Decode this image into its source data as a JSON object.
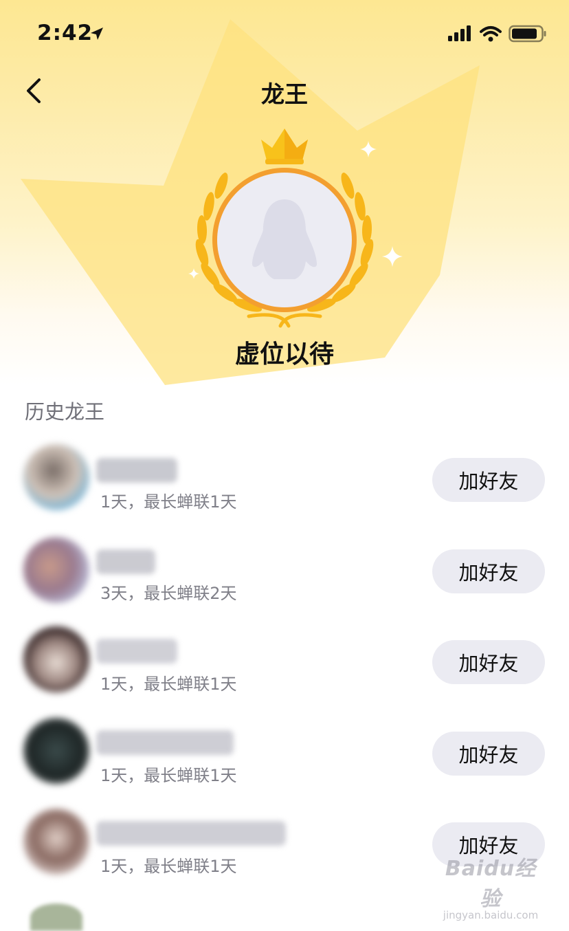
{
  "status_bar": {
    "time": "2:42"
  },
  "header": {
    "title": "龙王"
  },
  "winner": {
    "vacant_text": "虚位以待"
  },
  "history": {
    "section_title": "历史龙王",
    "rows": [
      {
        "subtitle": "1天，最长蝉联1天",
        "button_label": "加好友"
      },
      {
        "subtitle": "3天，最长蝉联2天",
        "button_label": "加好友"
      },
      {
        "subtitle": "1天，最长蝉联1天",
        "button_label": "加好友"
      },
      {
        "subtitle": "1天，最长蝉联1天",
        "button_label": "加好友"
      },
      {
        "subtitle": "1天，最长蝉联1天",
        "button_label": "加好友"
      }
    ]
  },
  "watermark": {
    "brand": "Baidu经验",
    "url": "jingyan.baidu.com"
  },
  "colors": {
    "accent_gold": "#f7b61a",
    "avatar_ring": "#f39f2f",
    "button_bg": "#ebebf2",
    "subtitle_gray": "#7f7f88"
  }
}
